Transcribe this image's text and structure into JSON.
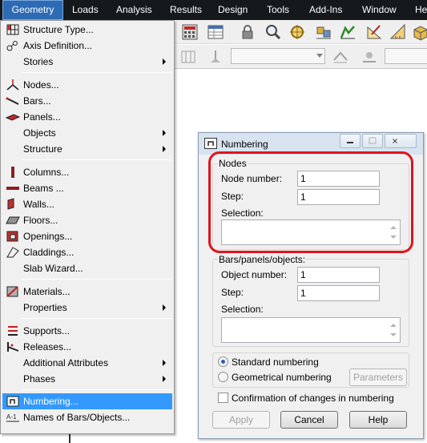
{
  "menubar": {
    "items": [
      "Geometry",
      "Loads",
      "Analysis",
      "Results",
      "Design",
      "Tools",
      "Add-Ins",
      "Window",
      "He"
    ]
  },
  "geometry_menu": {
    "items": [
      {
        "label": "Structure Type...",
        "icon": "structure-type-icon",
        "submenu": false
      },
      {
        "label": "Axis Definition...",
        "icon": "axis-definition-icon",
        "submenu": false
      },
      {
        "label": "Stories",
        "icon": "",
        "submenu": true
      },
      {
        "label": "Nodes...",
        "icon": "nodes-icon",
        "submenu": false
      },
      {
        "label": "Bars...",
        "icon": "bars-icon",
        "submenu": false
      },
      {
        "label": "Panels...",
        "icon": "panels-icon",
        "submenu": false
      },
      {
        "label": "Objects",
        "icon": "",
        "submenu": true
      },
      {
        "label": "Structure",
        "icon": "",
        "submenu": true
      },
      {
        "label": "Columns...",
        "icon": "columns-icon",
        "submenu": false
      },
      {
        "label": "Beams ...",
        "icon": "beams-icon",
        "submenu": false
      },
      {
        "label": "Walls...",
        "icon": "walls-icon",
        "submenu": false
      },
      {
        "label": "Floors...",
        "icon": "floors-icon",
        "submenu": false
      },
      {
        "label": "Openings...",
        "icon": "openings-icon",
        "submenu": false
      },
      {
        "label": "Claddings...",
        "icon": "claddings-icon",
        "submenu": false
      },
      {
        "label": "Slab Wizard...",
        "icon": "",
        "submenu": false
      },
      {
        "label": "Materials...",
        "icon": "materials-icon",
        "submenu": false
      },
      {
        "label": "Properties",
        "icon": "",
        "submenu": true
      },
      {
        "label": "Supports...",
        "icon": "supports-icon",
        "submenu": false
      },
      {
        "label": "Releases...",
        "icon": "releases-icon",
        "submenu": false
      },
      {
        "label": "Additional Attributes",
        "icon": "",
        "submenu": true
      },
      {
        "label": "Phases",
        "icon": "",
        "submenu": true
      },
      {
        "label": "Numbering...",
        "icon": "numbering-icon",
        "submenu": false
      },
      {
        "label": "Names of Bars/Objects...",
        "icon": "names-icon",
        "submenu": false
      }
    ],
    "highlighted": "Numbering..."
  },
  "dialog": {
    "title": "Numbering",
    "nodes_group": "Nodes",
    "node_number_label": "Node number:",
    "node_number_value": "1",
    "node_step_label": "Step:",
    "node_step_value": "1",
    "node_selection_label": "Selection:",
    "bars_group": "Bars/panels/objects:",
    "object_number_label": "Object number:",
    "object_number_value": "1",
    "object_step_label": "Step:",
    "object_step_value": "1",
    "object_selection_label": "Selection:",
    "standard_numbering": "Standard numbering",
    "geometrical_numbering": "Geometrical numbering",
    "selected_numbering": "standard",
    "parameters_button": "Parameters",
    "confirmation_label": "Confirmation of changes in numbering",
    "confirmation_checked": false,
    "apply_button": "Apply",
    "cancel_button": "Cancel",
    "help_button": "Help"
  },
  "colors": {
    "menubar_bg": "#15191c",
    "menu_highlight": "#3399ff",
    "annotation_outline": "#e0141e"
  }
}
